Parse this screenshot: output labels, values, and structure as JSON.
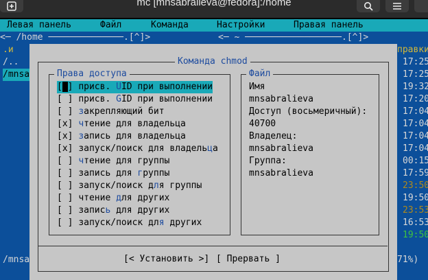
{
  "window": {
    "title": "mc [mnsabralieva@fedora]:/home"
  },
  "menubar": {
    "items": [
      "Левая панель",
      "Файл",
      "Команда",
      "Настройки",
      "Правая панель"
    ]
  },
  "left_panel": {
    "header": "<─ /home ──────────────.[^]>",
    "col_header": ".и",
    "entries": [
      "/..",
      "/mnsa"
    ],
    "footer": "/mnsa"
  },
  "right_panel": {
    "header": "<─ ~ ──────────────────.[^]>",
    "col_header": "правки",
    "times": [
      "17:25",
      "17:25",
      "19:32",
      "17:20",
      "17:04",
      "17:04",
      "17:04",
      "17:04",
      "00:15",
      "17:59",
      "23:50",
      "19:50",
      "23:53",
      "16:53",
      "19:50"
    ],
    "footer": "71%)"
  },
  "dialog": {
    "title": "Команда chmod",
    "rights_title": "Права доступа",
    "file_title": "Файл",
    "permissions": [
      {
        "box": "[ ]",
        "label": "присв. UID при выполнении",
        "hot": "U"
      },
      {
        "box": "[ ]",
        "label": "присв. GID при выполнении",
        "hot": "G"
      },
      {
        "box": "[ ]",
        "label": "закрепляющий бит",
        "hot": "з"
      },
      {
        "box": "[x]",
        "label": "чтение для владельца",
        "hot": "ч"
      },
      {
        "box": "[x]",
        "label": "запись для владельца",
        "hot": "з"
      },
      {
        "box": "[x]",
        "label": "запуск/поиск для владельца",
        "hot": "ц"
      },
      {
        "box": "[ ]",
        "label": "чтение для группы",
        "hot": "ч"
      },
      {
        "box": "[ ]",
        "label": "запись для группы",
        "hot": "г"
      },
      {
        "box": "[ ]",
        "label": "запуск/поиск для группы",
        "hot": "л"
      },
      {
        "box": "[ ]",
        "label": "чтение для других",
        "hot": "д"
      },
      {
        "box": "[ ]",
        "label": "запись для других",
        "hot": "ь"
      },
      {
        "box": "[ ]",
        "label": "запуск/поиск для других",
        "hot": "я"
      }
    ],
    "file_info": [
      "Имя",
      "mnsabralieva",
      "Доступ (восьмеричный):",
      "40700",
      "Владелец:",
      "mnsabralieva",
      "Группа:",
      "mnsabralieva"
    ],
    "buttons": {
      "set": "[< Установить >]",
      "abort": "[ Прервать ]"
    }
  }
}
